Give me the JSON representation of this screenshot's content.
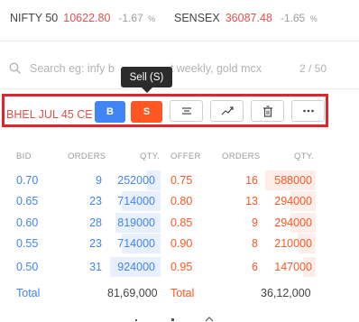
{
  "tickers": [
    {
      "name": "NIFTY 50",
      "value": "10622.80",
      "change": "-1.67",
      "pct": "%"
    },
    {
      "name": "SENSEX",
      "value": "36087.48",
      "change": "-1.65",
      "pct": "%"
    }
  ],
  "search": {
    "placeholder": "Search eg: infy b",
    "placeholder_rest": "t weekly, gold mcx",
    "count": "2 / 50"
  },
  "tooltip": "Sell (S)",
  "instrument": {
    "symbol": "BHEL JUL 45 CE",
    "buy_label": "B",
    "sell_label": "S"
  },
  "depth": {
    "headers": {
      "bid": "BID",
      "orders": "ORDERS",
      "qty": "QTY.",
      "offer": "OFFER",
      "orders2": "ORDERS",
      "qty2": "QTY."
    },
    "bids": [
      {
        "price": "0.70",
        "orders": "9",
        "qty": "252000"
      },
      {
        "price": "0.65",
        "orders": "23",
        "qty": "714000"
      },
      {
        "price": "0.60",
        "orders": "28",
        "qty": "819000"
      },
      {
        "price": "0.55",
        "orders": "23",
        "qty": "714000"
      },
      {
        "price": "0.50",
        "orders": "31",
        "qty": "924000"
      }
    ],
    "offers": [
      {
        "price": "0.75",
        "orders": "16",
        "qty": "588000"
      },
      {
        "price": "0.80",
        "orders": "13",
        "qty": "294000"
      },
      {
        "price": "0.85",
        "orders": "9",
        "qty": "294000"
      },
      {
        "price": "0.90",
        "orders": "8",
        "qty": "210000"
      },
      {
        "price": "0.95",
        "orders": "6",
        "qty": "147000"
      }
    ],
    "total_label": "Total",
    "total_bid": "81,69,000",
    "total_offer_label": "Total",
    "total_offer": "36,12,000"
  },
  "colors": {
    "buy": "#4184f3",
    "sell": "#ff5722",
    "down": "#df514c",
    "highlight": "#e0252f"
  },
  "icons": [
    "search-icon",
    "menu-lines-icon",
    "chart-trend-icon",
    "trash-icon",
    "more-dots-icon"
  ]
}
